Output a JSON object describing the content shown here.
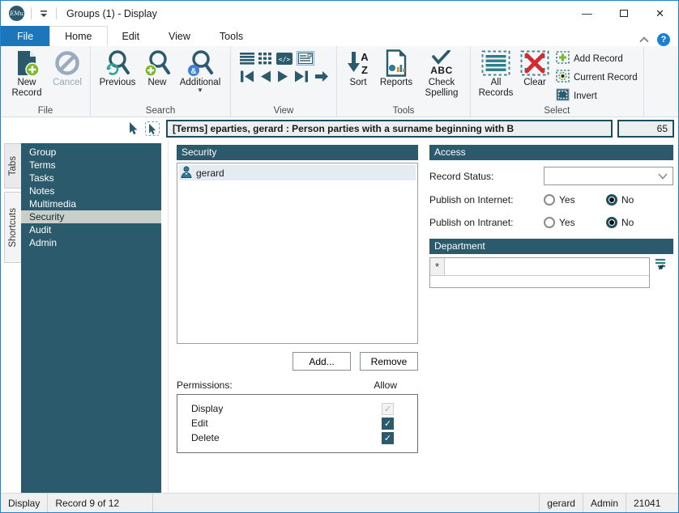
{
  "titlebar": {
    "logo_text": "EMu",
    "title": "Groups (1) - Display",
    "minimize": "—",
    "close": "✕"
  },
  "menu_tabs": {
    "file": "File",
    "home": "Home",
    "edit": "Edit",
    "view": "View",
    "tools": "Tools"
  },
  "ribbon": {
    "file_group": {
      "label": "File",
      "new_record": "New Record",
      "cancel": "Cancel"
    },
    "search_group": {
      "label": "Search",
      "previous": "Previous",
      "new": "New",
      "additional": "Additional"
    },
    "view_group": {
      "label": "View"
    },
    "tools_group": {
      "label": "Tools",
      "sort": "Sort",
      "reports": "Reports",
      "check_spelling": "Check Spelling",
      "abc": "ABC"
    },
    "select_group": {
      "label": "Select",
      "all_records": "All Records",
      "clear": "Clear",
      "add_record": "Add Record",
      "current_record": "Current Record",
      "invert": "Invert"
    }
  },
  "search_summary": {
    "text": "[Terms] eparties, gerard : Person parties with a surname beginning with B",
    "count": "65"
  },
  "side_tabs": {
    "tabs": "Tabs",
    "shortcuts": "Shortcuts"
  },
  "sidebar": {
    "items": [
      "Group",
      "Terms",
      "Tasks",
      "Notes",
      "Multimedia",
      "Security",
      "Audit",
      "Admin"
    ],
    "selected": "Security"
  },
  "security_panel": {
    "header": "Security",
    "users": [
      "gerard"
    ],
    "add_button": "Add...",
    "remove_button": "Remove",
    "permissions_label": "Permissions:",
    "allow_label": "Allow",
    "permissions": [
      {
        "name": "Display",
        "allow": true,
        "disabled": true
      },
      {
        "name": "Edit",
        "allow": true,
        "disabled": false
      },
      {
        "name": "Delete",
        "allow": true,
        "disabled": false
      }
    ]
  },
  "access_panel": {
    "header": "Access",
    "record_status_label": "Record Status:",
    "record_status_value": "",
    "publish_internet_label": "Publish on Internet:",
    "publish_intranet_label": "Publish on Intranet:",
    "yes_label": "Yes",
    "no_label": "No",
    "publish_internet_value": "No",
    "publish_intranet_value": "No"
  },
  "department_panel": {
    "header": "Department",
    "row_marker": "*",
    "value": ""
  },
  "statusbar": {
    "mode": "Display",
    "record_position": "Record 9 of 12",
    "user": "gerard",
    "group": "Admin",
    "irn": "21041"
  },
  "colors": {
    "teal_dark": "#2A5A6C",
    "teal_mid": "#2E7D8C",
    "accent_blue": "#1C76BC",
    "green": "#7AB929",
    "red": "#D42B30",
    "sidebar_selected_bg": "#C8CFC9"
  }
}
